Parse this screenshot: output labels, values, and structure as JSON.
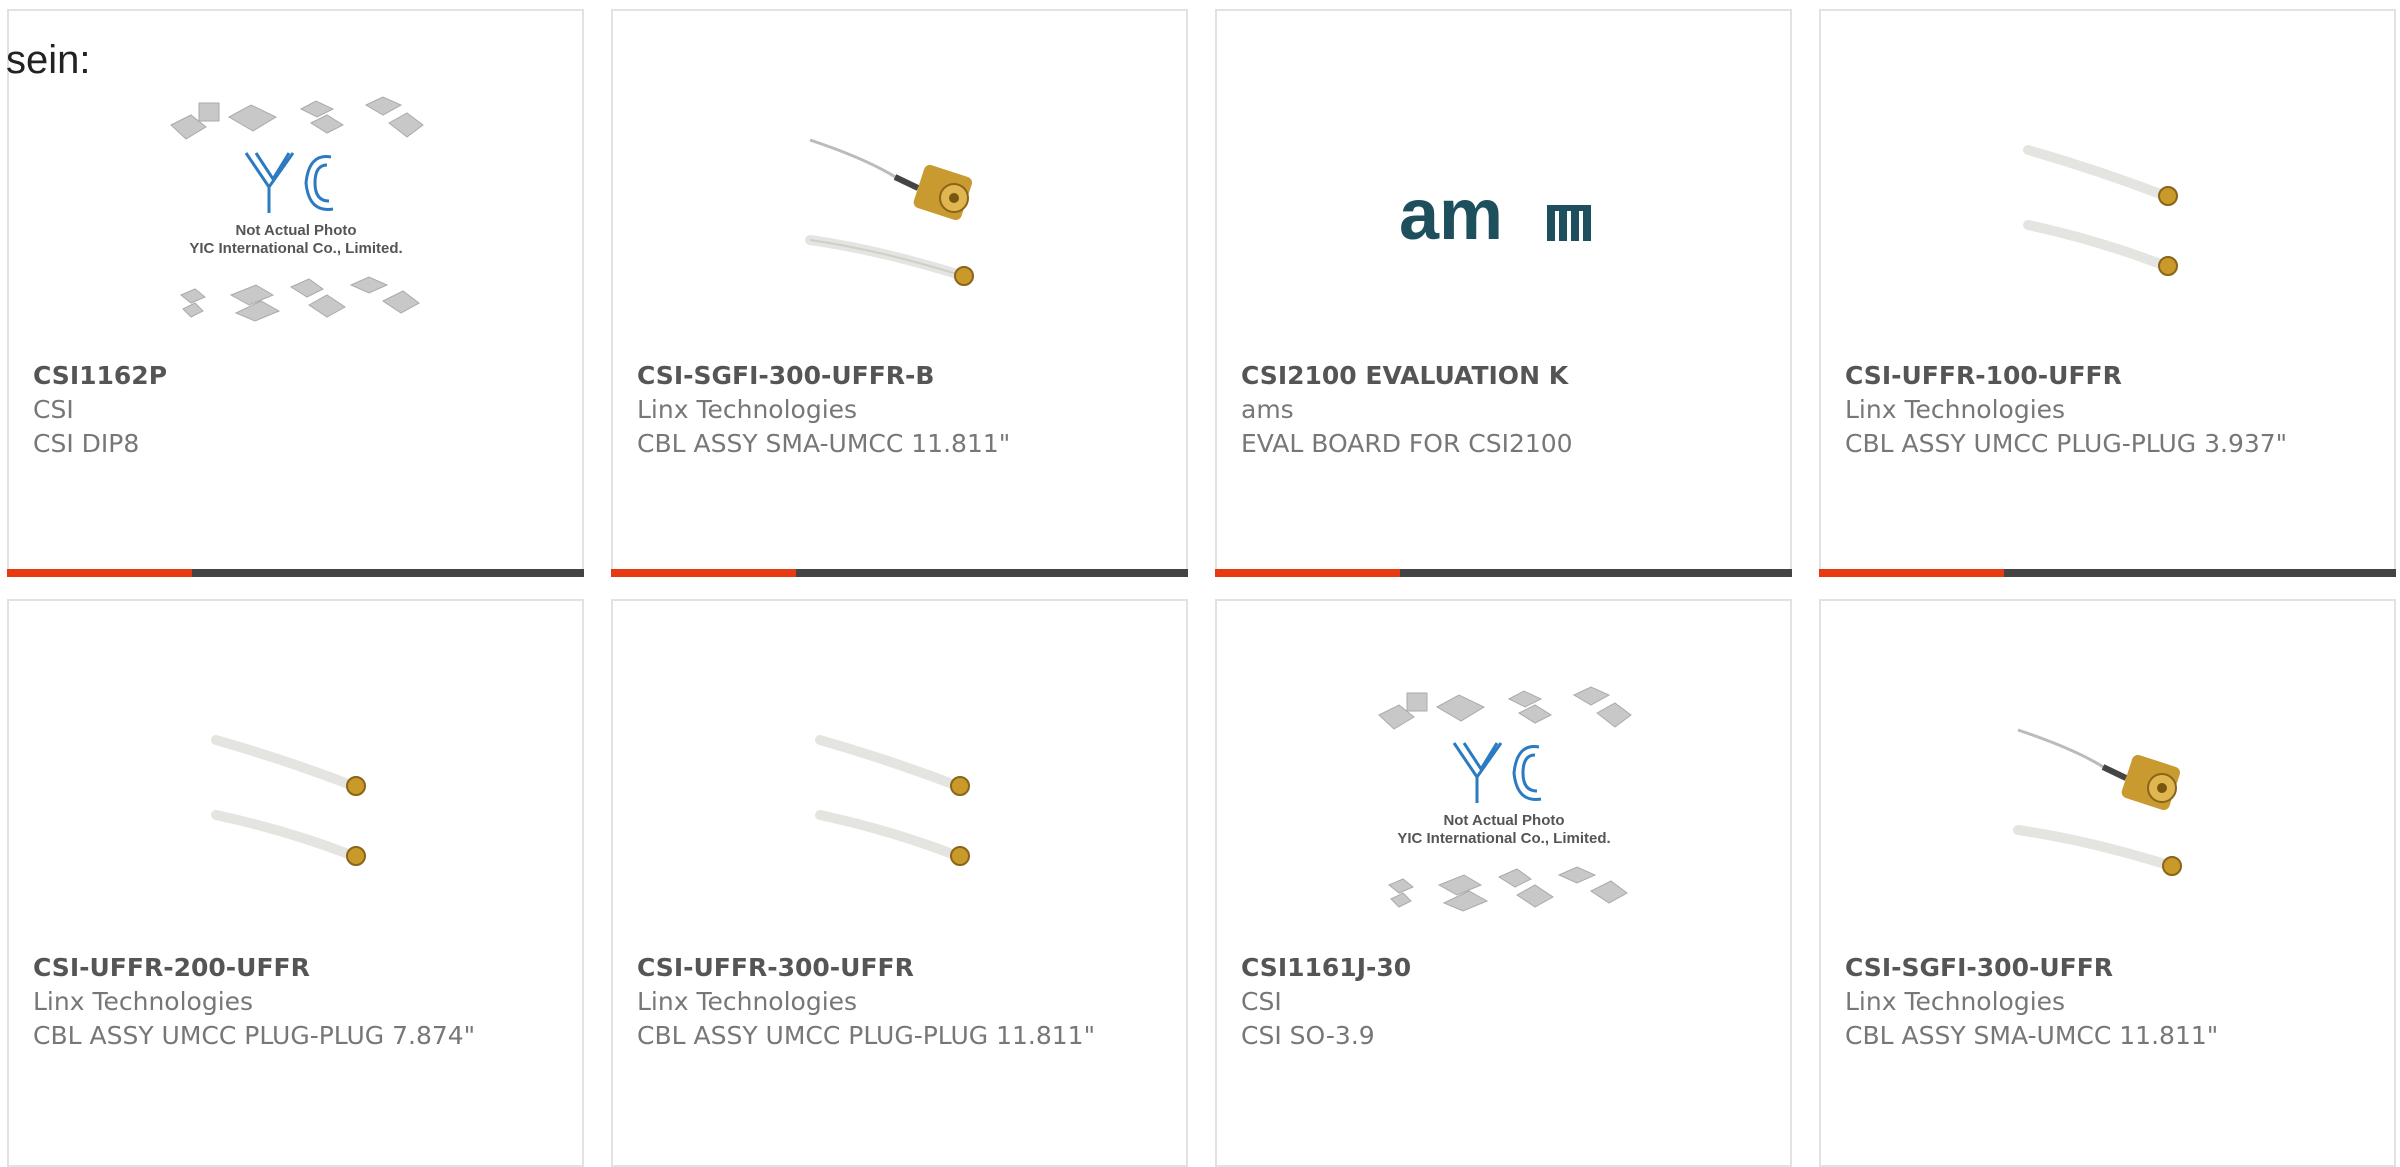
{
  "intro_text": "sein:",
  "products": [
    {
      "part_number": "CSI1162P",
      "manufacturer": "CSI",
      "description": "CSI DIP8",
      "image": "not-actual-photo-placeholder",
      "image_text": [
        "Not Actual Photo",
        "YIC International Co., Limited."
      ]
    },
    {
      "part_number": "CSI-SGFI-300-UFFR-B",
      "manufacturer": "Linx Technologies",
      "description": "CBL ASSY SMA-UMCC 11.811\"",
      "image": "sma-umcc-cable"
    },
    {
      "part_number": "CSI2100 EVALUATION K",
      "manufacturer": "ams",
      "description": "EVAL BOARD FOR CSI2100",
      "image": "ams-logo"
    },
    {
      "part_number": "CSI-UFFR-100-UFFR",
      "manufacturer": "Linx Technologies",
      "description": "CBL ASSY UMCC PLUG-PLUG 3.937\"",
      "image": "umcc-plug-plug-cable"
    },
    {
      "part_number": "CSI-UFFR-200-UFFR",
      "manufacturer": "Linx Technologies",
      "description": "CBL ASSY UMCC PLUG-PLUG 7.874\"",
      "image": "umcc-plug-plug-cable"
    },
    {
      "part_number": "CSI-UFFR-300-UFFR",
      "manufacturer": "Linx Technologies",
      "description": "CBL ASSY UMCC PLUG-PLUG 11.811\"",
      "image": "umcc-plug-plug-cable"
    },
    {
      "part_number": "CSI1161J-30",
      "manufacturer": "CSI",
      "description": "CSI SO-3.9",
      "image": "not-actual-photo-placeholder",
      "image_text": [
        "Not Actual Photo",
        "YIC International Co., Limited."
      ]
    },
    {
      "part_number": "CSI-SGFI-300-UFFR",
      "manufacturer": "Linx Technologies",
      "description": "CBL ASSY SMA-UMCC 11.811\"",
      "image": "sma-umcc-cable"
    }
  ],
  "colors": {
    "accent": "#e83a12",
    "bar": "#444444",
    "border": "#e2e2e2",
    "text": "#777777"
  }
}
